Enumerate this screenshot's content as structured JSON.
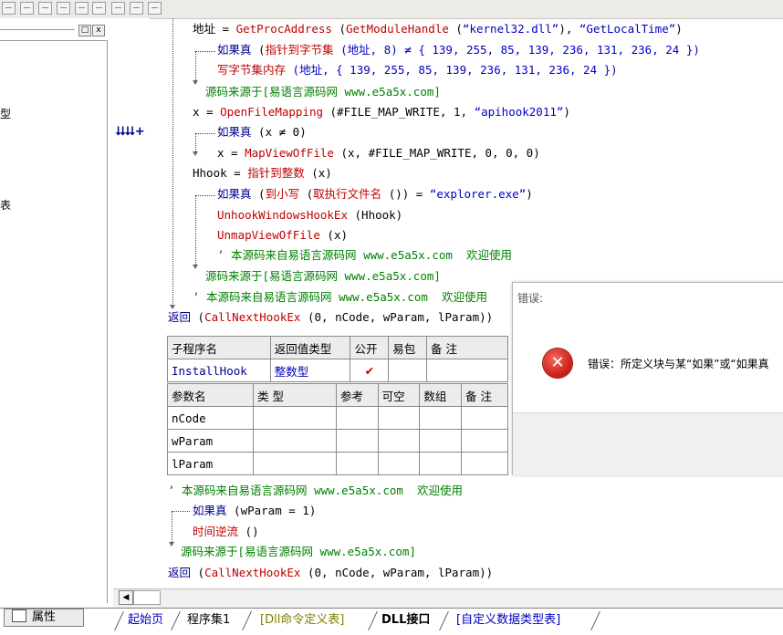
{
  "left_panel": {
    "chars": [
      "型",
      "表"
    ],
    "buttons": {
      "restore": "□",
      "close": "x"
    }
  },
  "gutter": {
    "marker": "⮇⮇+"
  },
  "code": {
    "line1": {
      "a": "地址 = ",
      "b": "GetProcAddress",
      "c": " (",
      "d": "GetModuleHandle",
      "e": " (",
      "f": "“kernel32.dll”",
      "g": "), ",
      "h": "“GetLocalTime”",
      "i": ")"
    },
    "line2": {
      "a": "如果真",
      "b": " (",
      "c": "指针到字节集",
      "d": " (地址, 8) ≠ { 139, 255, 85, 139, 236, 131, 236, 24 })"
    },
    "line3": {
      "a": "写字节集内存",
      "b": " (地址, { 139, 255, 85, 139, 236, 131, 236, 24 })"
    },
    "line4": "源码来源于[易语言源码网 www.e5a5x.com]",
    "line5": {
      "a": "x = ",
      "b": "OpenFileMapping",
      "c": " (#FILE_MAP_WRITE, 1, ",
      "d": "“apihook2011”",
      "e": ")"
    },
    "line6": {
      "a": "如果真",
      "b": " (x ≠ 0)"
    },
    "line7": {
      "a": "x = ",
      "b": "MapViewOfFile",
      "c": " (x, #FILE_MAP_WRITE, 0, 0, 0)"
    },
    "line8": {
      "a": "Hhook = ",
      "b": "指针到整数",
      "c": " (x)"
    },
    "line9": {
      "a": "如果真",
      "b": " (",
      "c": "到小写",
      "d": " (",
      "e": "取执行文件名",
      "f": " ()) = ",
      "g": "“explorer.exe”",
      "h": ")"
    },
    "line10": {
      "a": "UnhookWindowsHookEx",
      "b": " (Hhook)"
    },
    "line11": {
      "a": "UnmapViewOfFile",
      "b": " (x)"
    },
    "line12": "’ 本源码来自易语言源码网 www.e5a5x.com  欢迎使用",
    "line13": "源码来源于[易语言源码网 www.e5a5x.com]",
    "line14": "’ 本源码来自易语言源码网 www.e5a5x.com  欢迎使用",
    "line15": {
      "a": "返回",
      "b": " (",
      "c": "CallNextHookEx",
      "d": " (0, nCode, wParam, lParam))"
    },
    "line16": "’ 本源码来自易语言源码网 www.e5a5x.com  欢迎使用",
    "line17": {
      "a": "如果真",
      "b": " (wParam = 1)"
    },
    "line18": {
      "a": "时间逆流",
      "b": " ()"
    },
    "line19": "源码来源于[易语言源码网 www.e5a5x.com]",
    "line20": {
      "a": "返回",
      "b": " (",
      "c": "CallNextHookEx",
      "d": " (0, nCode, wParam, lParam))"
    }
  },
  "sub_table": {
    "headers": [
      "子程序名",
      "返回值类型",
      "公开",
      "易包",
      "备 注"
    ],
    "row": {
      "name": "InstallHook",
      "type": "整数型",
      "public": "✔",
      "pkg": "",
      "note": ""
    }
  },
  "param_table": {
    "headers": [
      "参数名",
      "类 型",
      "参考",
      "可空",
      "数组",
      "备 注"
    ],
    "rows": [
      [
        "nCode",
        "",
        "",
        "",
        "",
        ""
      ],
      [
        "wParam",
        "",
        "",
        "",
        "",
        ""
      ],
      [
        "lParam",
        "",
        "",
        "",
        "",
        ""
      ]
    ]
  },
  "dialog": {
    "title": "错误:",
    "icon": "error-icon",
    "message": "错误：所定义块与某“如果”或“如果真"
  },
  "bottom": {
    "prop_button": "属性",
    "scroll_left": "◀",
    "tabs": [
      "起始页",
      "程序集1",
      "[Dll命令定义表]",
      "DLL接口",
      "[自定义数据类型表]"
    ]
  },
  "colors": {
    "keyword": "#c00000",
    "function": "#0000c0",
    "comment": "#008000",
    "dialog_icon": "#c81c12"
  }
}
